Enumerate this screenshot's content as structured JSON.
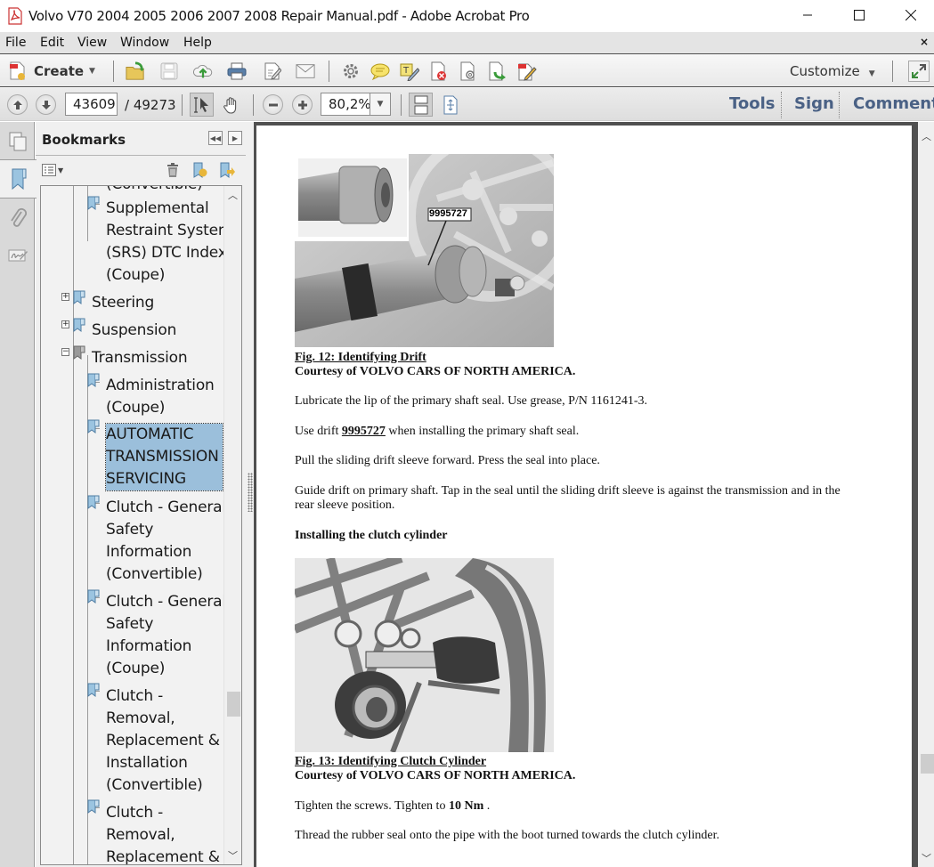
{
  "window": {
    "title": "Volvo V70 2004 2005 2006 2007 2008 Repair Manual.pdf - Adobe Acrobat Pro",
    "app_icon": "pdf-icon",
    "controls": [
      "minimize-icon",
      "maximize-icon",
      "close-icon"
    ]
  },
  "menubar": {
    "items": [
      "File",
      "Edit",
      "View",
      "Window",
      "Help"
    ],
    "close_doc": "×"
  },
  "toolbar": {
    "create_label": "Create",
    "icons": [
      "open-icon",
      "save-icon",
      "cloud-upload-icon",
      "print-icon",
      "edit-document-icon",
      "email-icon",
      "settings-icon",
      "comment-icon",
      "highlight-text-icon",
      "delete-page-icon",
      "attach-file-icon",
      "export-icon",
      "sign-document-icon"
    ],
    "customize_label": "Customize",
    "expand_icon": "expand-icon"
  },
  "navbar": {
    "current_page": "43609",
    "total_pages": "/ 49273",
    "zoom": "80,2%",
    "panes": [
      "Tools",
      "Sign",
      "Comment"
    ]
  },
  "bookmarks": {
    "title": "Bookmarks",
    "items": [
      {
        "label": "(Convertible)",
        "level": 2,
        "clipped": true
      },
      {
        "label": "Supplemental\nRestraint System\n(SRS) DTC Index\n(Coupe)",
        "level": 2
      },
      {
        "label": "Steering",
        "level": 1,
        "expander": "+"
      },
      {
        "label": "Suspension",
        "level": 1,
        "expander": "+"
      },
      {
        "label": "Transmission",
        "level": 1,
        "expander": "−"
      },
      {
        "label": "Administration\n(Coupe)",
        "level": 2
      },
      {
        "label": "AUTOMATIC\nTRANSMISSION\nSERVICING",
        "level": 2,
        "selected": true
      },
      {
        "label": "Clutch - General\nSafety\nInformation\n(Convertible)",
        "level": 2
      },
      {
        "label": "Clutch - General\nSafety\nInformation\n(Coupe)",
        "level": 2
      },
      {
        "label": "Clutch -\nRemoval,\nReplacement &\nInstallation\n(Convertible)",
        "level": 2
      },
      {
        "label": "Clutch -\nRemoval,\nReplacement &",
        "level": 2
      }
    ]
  },
  "document": {
    "fig12": {
      "callout": "9995727",
      "caption": "Fig. 12: Identifying Drift",
      "courtesy": "Courtesy of VOLVO CARS OF NORTH AMERICA."
    },
    "para1": "Lubricate the lip of the primary shaft seal. Use grease, P/N 1161241-3.",
    "para2_pre": "Use drift ",
    "para2_part": "9995727",
    "para2_post": " when installing the primary shaft seal.",
    "para3": "Pull the sliding drift sleeve forward. Press the seal into place.",
    "para4_line1": "Guide drift on primary shaft. Tap in the seal until the sliding drift sleeve is against the transmission and in the",
    "para4_line2": "rear sleeve position.",
    "heading": "Installing the clutch cylinder",
    "fig13": {
      "caption": "Fig. 13: Identifying Clutch Cylinder",
      "courtesy": "Courtesy of VOLVO CARS OF NORTH AMERICA."
    },
    "para5_pre": "Tighten the screws. Tighten to ",
    "para5_value": "10 Nm",
    "para5_post": " .",
    "para6": "Thread the rubber seal onto the pipe with the boot turned towards the clutch cylinder."
  }
}
